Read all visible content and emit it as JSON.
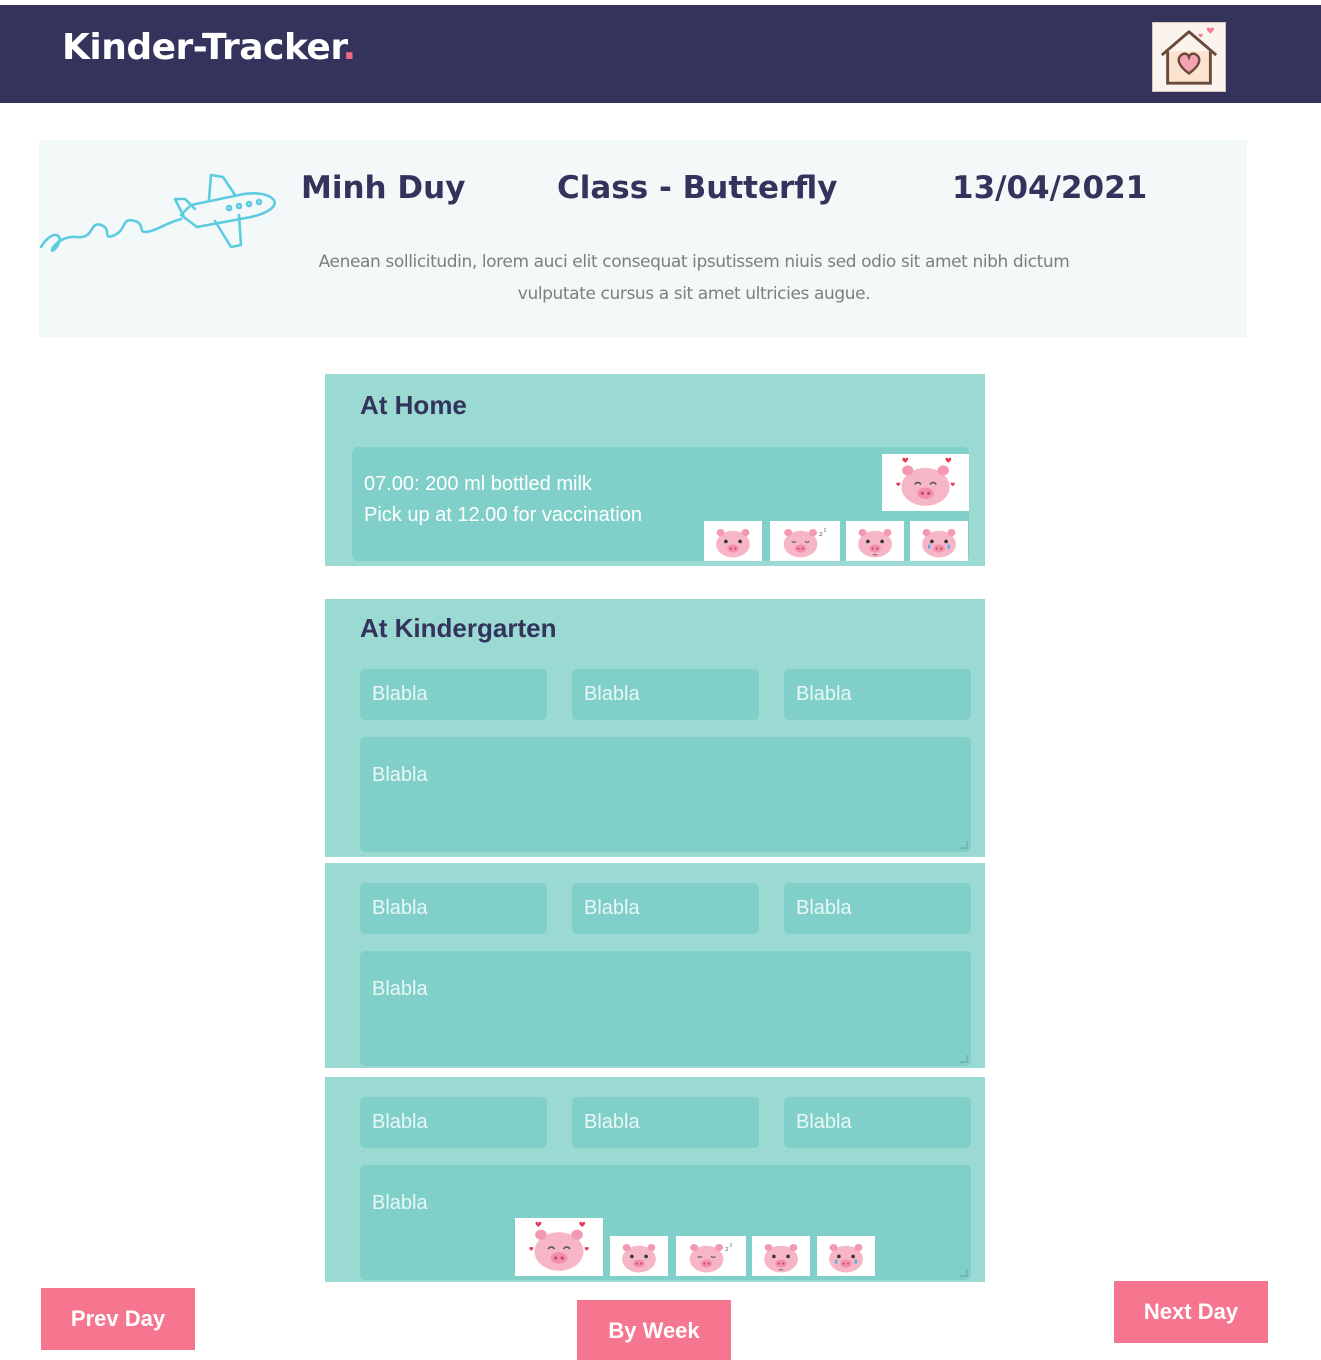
{
  "header": {
    "brand": "Kinder-Tracker",
    "brand_dot": ".",
    "home_icon": "house-heart-icon"
  },
  "child": {
    "name": "Minh Duy",
    "class_label": "Class - Butterfly",
    "date": "13/04/2021",
    "description": "Aenean sollicitudin, lorem auci elit consequat ipsutissem niuis sed odio sit amet nibh dictum vulputate cursus a sit amet ultricies augue."
  },
  "at_home": {
    "title": "At Home",
    "note_line_1": "07.00:  200 ml bottled milk",
    "note_line_2": "Pick up at 12.00 for vaccination",
    "mood_icons": [
      "pig-love-icon",
      "pig-happy-icon",
      "pig-sleepy-icon",
      "pig-neutral-icon",
      "pig-crying-icon"
    ]
  },
  "at_kindergarten": {
    "title": "At Kindergarten",
    "entries": [
      {
        "field_1": "Blabla",
        "field_2": "Blabla",
        "field_3": "Blabla",
        "notes": "Blabla"
      },
      {
        "field_1": "Blabla",
        "field_2": "Blabla",
        "field_3": "Blabla",
        "notes": "Blabla"
      },
      {
        "field_1": "Blabla",
        "field_2": "Blabla",
        "field_3": "Blabla",
        "notes": "Blabla"
      }
    ],
    "mood_icons": [
      "pig-love-icon",
      "pig-happy-icon",
      "pig-sleepy-icon",
      "pig-neutral-icon",
      "pig-crying-icon"
    ]
  },
  "navigation": {
    "prev": "Prev Day",
    "week": "By Week",
    "next": "Next Day"
  },
  "colors": {
    "header_bg": "#33335c",
    "accent_pink": "#f6758f",
    "card_bg": "#9bd9d3",
    "field_bg": "#80d0c9",
    "banner_bg": "#f3f8f8"
  }
}
